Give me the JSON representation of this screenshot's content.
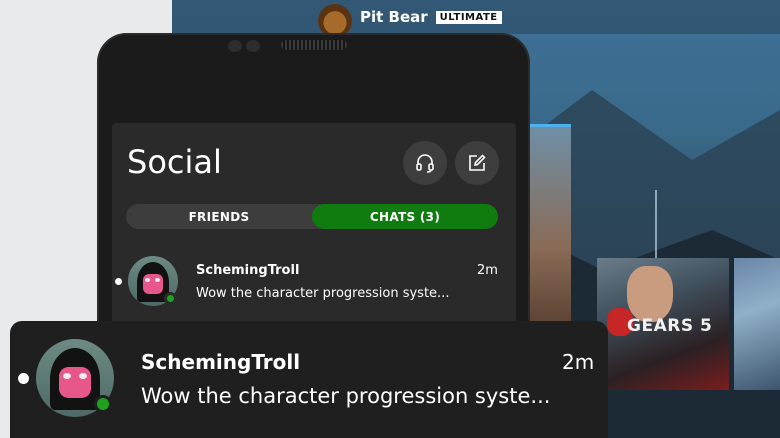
{
  "console": {
    "gamertag": "Pit Bear",
    "badge": "ULTIMATE",
    "tile_game_title": "GEARS 5"
  },
  "social": {
    "title": "Social",
    "headset_icon": "headset-icon",
    "compose_icon": "compose-icon",
    "tabs": [
      {
        "label": "FRIENDS",
        "active": false
      },
      {
        "label": "CHATS (3)",
        "active": true
      }
    ],
    "chats": [
      {
        "name": "SchemingTroll",
        "message": "Wow the character progression syste...",
        "time": "2m",
        "unread": true,
        "online": true
      }
    ]
  },
  "notification": {
    "name": "SchemingTroll",
    "message": "Wow the character progression syste...",
    "time": "2m",
    "unread": true,
    "online": true
  },
  "colors": {
    "accent_green": "#107c10",
    "online_green": "#1fa31f",
    "panel_dark": "#2a2a2a",
    "toast_dark": "#1f1f1f"
  }
}
